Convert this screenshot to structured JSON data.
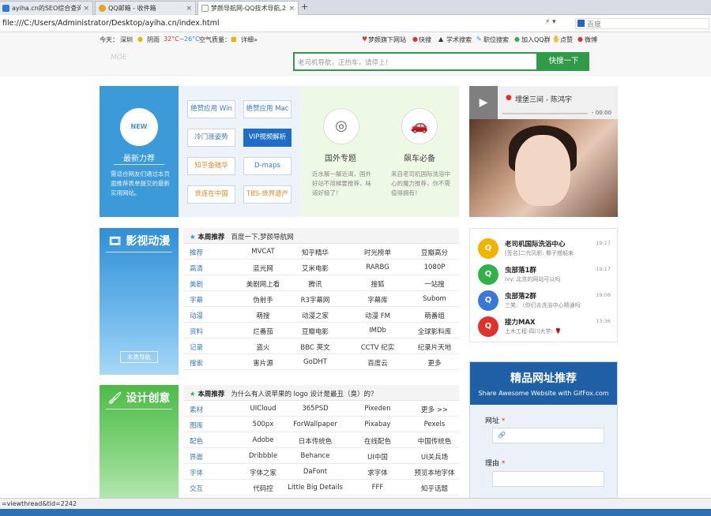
{
  "browser": {
    "tabs": [
      {
        "label": "ayiha.cn的SEO综合查询 - 站",
        "color": "#2f7bd1",
        "active": false
      },
      {
        "label": "QQ邮箱 - 收件箱",
        "color": "#e8a21c",
        "active": false
      },
      {
        "label": "梦颜导航网-QQ技术导航,2",
        "color": "#888888",
        "active": true
      }
    ],
    "new_tab": "+",
    "close": "×",
    "url": "file:///C:/Users/Administrator/Desktop/ayiha.cn/index.html",
    "search_placeholder": "百度"
  },
  "infobar": {
    "today": "今天：",
    "city": "深圳",
    "weather": "阴雨",
    "temp_high": "32°C~",
    "temp_low": "26°C",
    "air": "空气质量：",
    "air_detail": "详细»",
    "links": [
      "梦颜旗下网站",
      "快搜",
      "学术搜索",
      "职位搜索",
      "加入QQ群",
      "点赞",
      "微博"
    ]
  },
  "header": {
    "logo": "MOE",
    "search_placeholder": "老司机导航，正热车，请停上！",
    "search_button": "快搜一下"
  },
  "featured": {
    "badge": "NEW",
    "title": "最新力荐",
    "desc": "需适合网友们通过本页面推荐表单提交的最新实用网站。",
    "buttons": [
      {
        "label": "绝赞应用 Win",
        "style": "normal"
      },
      {
        "label": "绝赞应用 Mac",
        "style": "normal"
      },
      {
        "label": "冷门涨姿势",
        "style": "normal"
      },
      {
        "label": "VIP视频解析",
        "style": "vip"
      },
      {
        "label": "知乎金碴华",
        "style": "org"
      },
      {
        "label": "D-maps",
        "style": "normal"
      },
      {
        "label": "世连在中国",
        "style": "org"
      },
      {
        "label": "TBS-世界遗产",
        "style": "org"
      }
    ],
    "abroad": {
      "title": "国外专题",
      "desc": "近水解一解近渴，国外好站不用梯要推荐，味道好极了！"
    },
    "car": {
      "title": "飙车必备",
      "desc": "来自老司机国际洗浴中心的魔力推荐，你不需值得拥有！"
    }
  },
  "music": {
    "title": "埋堡三间 - 陈鸿宇",
    "time": "- 00:00"
  },
  "movie": {
    "title": "影视动漫",
    "bottom": "本类导航",
    "head_label": "本周推荐",
    "head_text": "百度一下,梦颜导航网",
    "rows": [
      [
        "推荐",
        "MVCAT",
        "知乎精华",
        "时光榜单",
        "豆瓣高分"
      ],
      [
        "高清",
        "蓝光网",
        "艾米电影",
        "RARBG",
        "1080P"
      ],
      [
        "美剧",
        "美剧网上看",
        "腾讯",
        "搜狐",
        "一站搜"
      ],
      [
        "字幕",
        "伪射手",
        "R3字幕网",
        "字幕库",
        "Subom"
      ],
      [
        "动漫",
        "萌搜",
        "动漫之家",
        "动漫 FM",
        "萌番组"
      ],
      [
        "资料",
        "烂番茄",
        "豆瓣电影",
        "IMDb",
        "全球影料库"
      ],
      [
        "记录",
        "盗火",
        "BBC 英文",
        "CCTV 纪实",
        "纪录片天地"
      ],
      [
        "搜索",
        "害片源",
        "GoDHT",
        "百度云",
        "更多"
      ]
    ]
  },
  "design": {
    "title": "设计创意",
    "head_label": "本周推荐",
    "head_text": "为什么有人说苹果的 logo 设计是最丑（臭）的？",
    "rows": [
      [
        "素材",
        "UICloud",
        "365PSD",
        "Pixeden",
        "更多 >>"
      ],
      [
        "图库",
        "500px",
        "ForWallpaper",
        "Pixabay",
        "Pexels"
      ],
      [
        "配色",
        "Adobe",
        "日本传统色",
        "在线配色",
        "中国传统色"
      ],
      [
        "界面",
        "Dribbble",
        "Behance",
        "UI中国",
        "UI关兵场"
      ],
      [
        "字体",
        "字体之家",
        "DaFont",
        "求字体",
        "预览本地字体"
      ],
      [
        "交互",
        "代码控",
        "Little Big Details",
        "FFF",
        "知乎话题"
      ]
    ]
  },
  "chat": [
    {
      "name": "老司机国际洗浴中心",
      "msg": "[签名]二代风影: 椰子搭船来",
      "time": "19:17",
      "color": "#f0b400"
    },
    {
      "name": "虫部落1群",
      "msg": "Ivy: 北京的网站可以吗",
      "time": "19:17",
      "color": "#2fb24a"
    },
    {
      "name": "虫部落2群",
      "msg": "三笑: （你们去洗浴中心精通吗",
      "time": "19:08",
      "color": "#3a78d8"
    },
    {
      "name": "接力MAX",
      "msg": "土木工程-四川大学: 🌹",
      "time": "13:36",
      "color": "#e0322d"
    }
  ],
  "recommend": {
    "title": "精品网址推荐",
    "subtitle": "Share Awesome Website with GifFox.com",
    "url_label": "网址",
    "reason_label": "理由",
    "required": "*"
  },
  "status": "=viewthread&tid=2242"
}
